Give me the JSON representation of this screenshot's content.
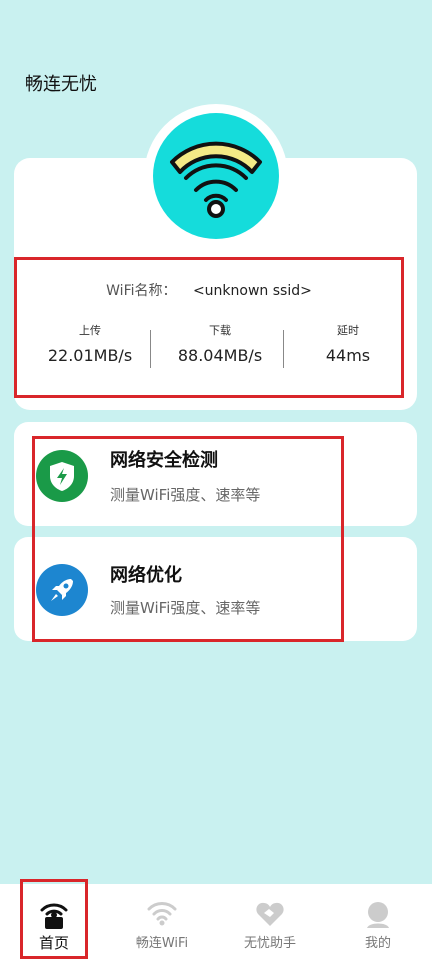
{
  "app": {
    "title": "畅连无忧"
  },
  "wifi_info": {
    "ssid_label": "WiFi名称：",
    "ssid_value": "<unknown ssid>",
    "upload_label": "上传",
    "upload_value": "22.01MB/s",
    "download_label": "下载",
    "download_value": "88.04MB/s",
    "latency_label": "延时",
    "latency_value": "44ms"
  },
  "features": [
    {
      "title": "网络安全检测",
      "subtitle": "测量WiFi强度、速率等",
      "icon": "shield-bolt-icon",
      "color": "#1a9a48"
    },
    {
      "title": "网络优化",
      "subtitle": "测量WiFi强度、速率等",
      "icon": "rocket-icon",
      "color": "#1d86d0"
    }
  ],
  "tabs": [
    {
      "label": "首页",
      "icon": "home-wifi-lock-icon",
      "active": true
    },
    {
      "label": "畅连WiFi",
      "icon": "wifi-icon",
      "active": false
    },
    {
      "label": "无忧助手",
      "icon": "helper-heart-icon",
      "active": false
    },
    {
      "label": "我的",
      "icon": "profile-icon",
      "active": false
    }
  ],
  "colors": {
    "background": "#c9f1f0",
    "accent_cyan": "#15dcdb",
    "highlight_red": "#d9262a"
  }
}
